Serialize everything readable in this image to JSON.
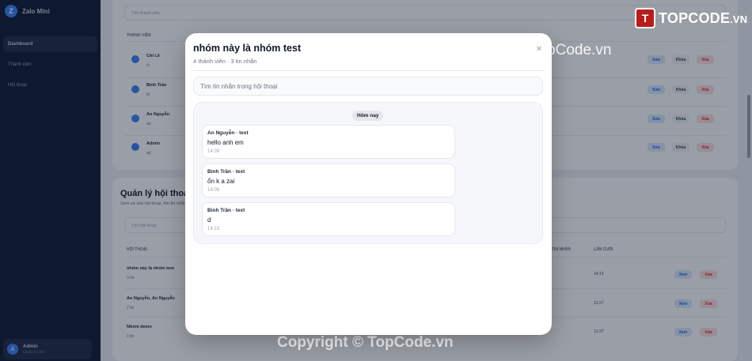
{
  "sidebar": {
    "brand_initial": "Z",
    "brand_name": "Zalo Mini",
    "items": [
      {
        "label": "Dashboard",
        "active": true
      },
      {
        "label": "Thành viên",
        "active": false
      },
      {
        "label": "Hội thoại",
        "active": false
      }
    ],
    "user": {
      "initial": "A",
      "name": "Admin",
      "role": "Quản trị viên"
    }
  },
  "background": {
    "member_search_placeholder": "Tìm thành viên",
    "member_header": "THÀNH VIÊN",
    "members": [
      {
        "name": "Chi Lê",
        "sub": "cl"
      },
      {
        "name": "Bình Trần",
        "sub": "bt"
      },
      {
        "name": "An Nguyễn",
        "sub": "an"
      },
      {
        "name": "Admin",
        "sub": "ad"
      }
    ],
    "member_actions": {
      "view": "Sửa",
      "mute": "Khóa",
      "delete": "Xóa"
    },
    "conv_title": "Quản lý hội thoại",
    "conv_desc": "Xem và xóa hội thoại, tìm tin nhắn",
    "conv_search_placeholder": "Tìm hội thoại",
    "conv_header_name": "HỘI THOẠI",
    "conv_header_count": "TIN NHẮN",
    "conv_header_last": "LẦN CUỐI",
    "conversations": [
      {
        "name": "nhóm này là nhóm test",
        "sub": "3 tin",
        "time": "14:13"
      },
      {
        "name": "An Nguyễn, An Nguyễn",
        "sub": "2 tin",
        "time": "13:27"
      },
      {
        "name": "Nhóm demo",
        "sub": "0 tin",
        "time": "13:27"
      }
    ],
    "conv_actions": {
      "view": "Xem",
      "delete": "Xóa"
    }
  },
  "watermark": {
    "logo_mark": "T",
    "logo_text": "TOPCODE",
    "logo_domain": ".VN",
    "top_text": "TopCode.vn",
    "copyright": "Copyright © TopCode.vn"
  },
  "modal": {
    "title": "nhóm này là nhóm test",
    "subtitle": "4 thành viên · 3 tin nhắn",
    "close_glyph": "✕",
    "search_placeholder": "Tìm tin nhắn trong hội thoại",
    "search_value": "",
    "day_label": "Hôm nay",
    "messages": [
      {
        "sender": "An Nguyễn · text",
        "text": "hello anh em",
        "time": "14:09"
      },
      {
        "sender": "Bình Trần · text",
        "text": "ổn k a zai",
        "time": "14:09"
      },
      {
        "sender": "Bình Trần · text",
        "text": "d",
        "time": "14:13"
      }
    ]
  },
  "colors": {
    "accent": "#3b82f6",
    "sidebar_bg": "#0f1b33",
    "danger": "#dc2626"
  }
}
